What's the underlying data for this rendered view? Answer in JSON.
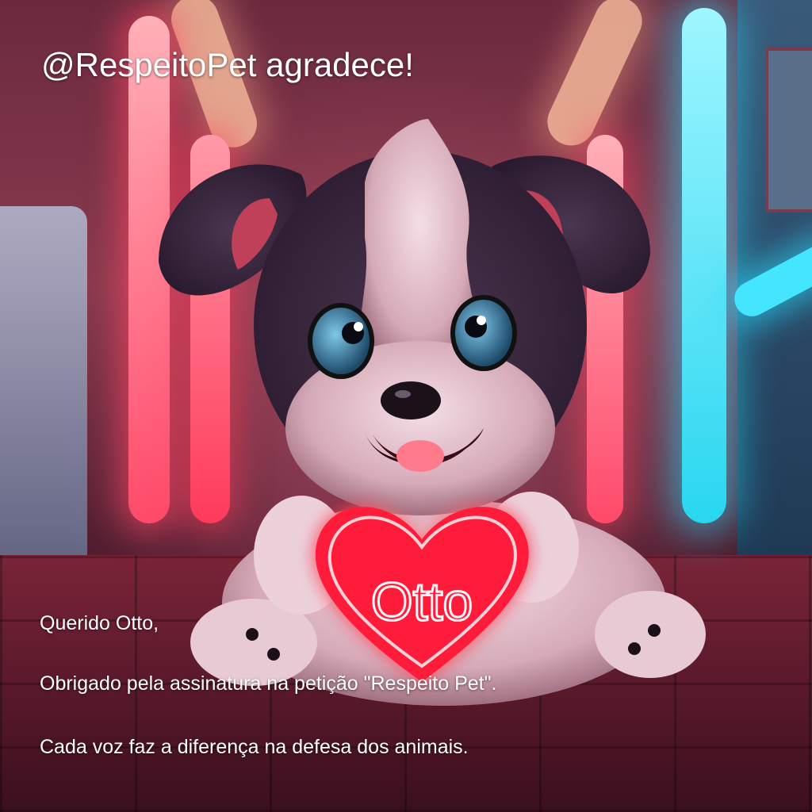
{
  "headline": "@RespeitoPet agradece!",
  "heart_name": "Otto",
  "message": {
    "greeting": "Querido Otto,",
    "thanks": "Obrigado pela assinatura na petição \"Respeito Pet\".",
    "closing": "Cada voz faz a diferença na defesa dos animais."
  },
  "colors": {
    "neon_pink": "#ff4a6a",
    "neon_cyan": "#29d6f0",
    "heart_red": "#ff1a3a",
    "text": "#ffffff"
  }
}
